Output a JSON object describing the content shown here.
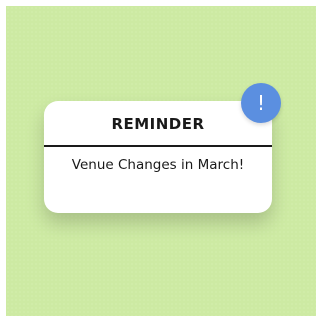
{
  "card": {
    "title": "REMINDER",
    "message": "Venue Changes in March!"
  },
  "badge": {
    "symbol": "!",
    "icon": "exclamation-icon",
    "color": "#5b8fe0"
  },
  "colors": {
    "background": "#cdeaa3",
    "card": "#ffffff",
    "text": "#1a1a1a"
  }
}
